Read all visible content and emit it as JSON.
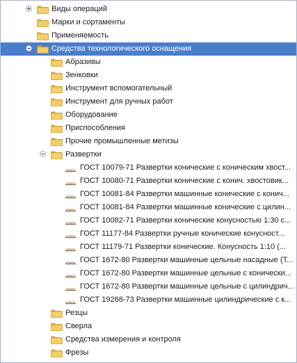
{
  "tree": {
    "top_items": [
      {
        "label": "Виды операций",
        "toggle": "plus"
      },
      {
        "label": "Марки и сортаменты"
      },
      {
        "label": "Применяемость"
      }
    ],
    "selected_item": {
      "label": "Средства технологического оснащения",
      "toggle": "minus"
    },
    "children_before": [
      {
        "label": "Абразивы"
      },
      {
        "label": "Зенковки"
      },
      {
        "label": "Инструмент вспомогательный"
      },
      {
        "label": "Инструмент для ручных работ"
      },
      {
        "label": "Оборудование"
      },
      {
        "label": "Приспособления"
      },
      {
        "label": "Прочие промышленные метизы"
      }
    ],
    "expanded_child": {
      "label": "Развертки",
      "toggle": "minus"
    },
    "documents": [
      {
        "label": "ГОСТ 10079-71 Развертки конические с коническим хвост..."
      },
      {
        "label": "ГОСТ 10080-71 Развертки конические с конич. хвостовик..."
      },
      {
        "label": "ГОСТ 10081-84 Развертки машинные конические с конич..."
      },
      {
        "label": "ГОСТ 10081-84 Развертки машинные конические с цилин..."
      },
      {
        "label": "ГОСТ 10082-71 Развертки конические конусностью 1:30 с..."
      },
      {
        "label": "ГОСТ 11177-84 Развертки ручные конические конусност..."
      },
      {
        "label": "ГОСТ 11179-71 Развертки конические. Конусность 1:10 (..."
      },
      {
        "label": "ГОСТ 1672-80 Развертки машинные цельные насадные (Т..."
      },
      {
        "label": "ГОСТ 1672-80 Развертки машинные цельные с конически..."
      },
      {
        "label": "ГОСТ 1672-80 Развертки машинные цельные с цилиндрич..."
      },
      {
        "label": "ГОСТ 19268-73 Развертки машинные цилиндрические с к..."
      }
    ],
    "children_after": [
      {
        "label": "Резцы"
      },
      {
        "label": "Сверла"
      },
      {
        "label": "Средства измерения и контроля"
      },
      {
        "label": "Фрезы"
      }
    ]
  },
  "colors": {
    "selection": "#4a7ecb",
    "folder": "#f2cf6b",
    "folder_dark": "#d9a93b",
    "border": "#a9b2bf"
  },
  "icons": {
    "folder": "folder-icon",
    "document": "document-icon",
    "expand": "expand-plus-icon",
    "collapse": "collapse-minus-icon"
  }
}
